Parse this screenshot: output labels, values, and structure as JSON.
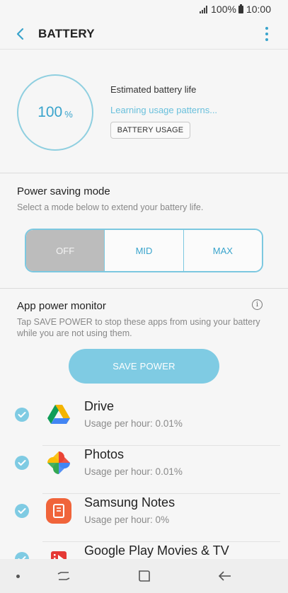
{
  "status_bar": {
    "battery_pct": "100%",
    "time": "10:00"
  },
  "appbar": {
    "title": "BATTERY"
  },
  "battery": {
    "level": "100",
    "unit": "%",
    "estimated_label": "Estimated battery life",
    "learning_text": "Learning usage patterns...",
    "usage_button": "BATTERY USAGE"
  },
  "power_saving": {
    "title": "Power saving mode",
    "subtitle": "Select a mode below to extend your battery life.",
    "modes": [
      "OFF",
      "MID",
      "MAX"
    ],
    "selected": "OFF"
  },
  "app_power_monitor": {
    "title": "App power monitor",
    "description": "Tap SAVE POWER to stop these apps from using your battery while you are not using them.",
    "save_button": "SAVE POWER",
    "apps": [
      {
        "name": "Drive",
        "usage": "Usage per hour: 0.01%",
        "icon": "google-drive-icon"
      },
      {
        "name": "Photos",
        "usage": "Usage per hour: 0.01%",
        "icon": "google-photos-icon"
      },
      {
        "name": "Samsung Notes",
        "usage": "Usage per hour: 0%",
        "icon": "samsung-notes-icon"
      },
      {
        "name": "Google Play Movies & TV",
        "usage": "",
        "icon": "play-movies-icon"
      }
    ]
  },
  "colors": {
    "accent": "#3aa4cc",
    "accent_light": "#7fcbe3",
    "selected_segment": "#bcbcbc"
  }
}
